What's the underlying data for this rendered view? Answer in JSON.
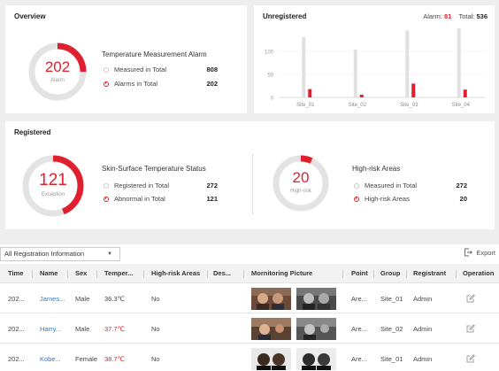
{
  "overview": {
    "title": "Overview",
    "ring_value": "202",
    "ring_label": "Alarm",
    "ring_fraction": 0.25,
    "heading": "Temperature Measurement Alarm",
    "rows": [
      {
        "label": "Measured in Total",
        "value": "808"
      },
      {
        "label": "Alarms in Total",
        "value": "202"
      }
    ]
  },
  "unregistered": {
    "title": "Unregistered",
    "alarm_label": "Alarm:",
    "alarm_value": "81",
    "total_label": "Total:",
    "total_value": "536",
    "y_ticks": [
      "100",
      "50",
      "0"
    ]
  },
  "chart_data": {
    "type": "bar",
    "categories": [
      "Site_01",
      "Site_02",
      "Site_03",
      "Site_04"
    ],
    "series": [
      {
        "values": [
          131,
          104,
          145,
          156
        ]
      },
      {
        "values": [
          18,
          6,
          30,
          17
        ]
      }
    ],
    "ylim": [
      0,
      150
    ],
    "y_ticks": [
      0,
      50,
      100
    ],
    "colors": [
      "#e0e0e0",
      "#e0202e"
    ]
  },
  "registered": {
    "title": "Registered",
    "skin": {
      "ring_value": "121",
      "ring_label": "Exception",
      "ring_fraction": 0.44,
      "heading": "Skin-Surface Temperature Status",
      "rows": [
        {
          "label": "Registered in Total",
          "value": "272"
        },
        {
          "label": "Abnormal in Total",
          "value": "121"
        }
      ]
    },
    "risk": {
      "ring_value": "20",
      "ring_label": "High-risk",
      "ring_fraction": 0.07,
      "heading": "High-risk Areas",
      "rows": [
        {
          "label": "Measured in Total",
          "value": "272"
        },
        {
          "label": "High-risk Areas",
          "value": "20"
        }
      ]
    }
  },
  "toolbar": {
    "filter_value": "All Registration Information",
    "export_label": "Export"
  },
  "table": {
    "columns": [
      "Time",
      "Name",
      "Sex",
      "Temper...",
      "High-risk Areas",
      "Des...",
      "Mornitoring Picture",
      "Point",
      "Group",
      "Registrant",
      "Operation"
    ],
    "rows": [
      {
        "time": "202...",
        "name": "James...",
        "sex": "Male",
        "temp": "36.3℃",
        "temp_abnormal": false,
        "risk": "No",
        "point": "Are...",
        "group": "Site_01",
        "registrant": "Admin"
      },
      {
        "time": "202...",
        "name": "Harry...",
        "sex": "Male",
        "temp": "37.7℃",
        "temp_abnormal": true,
        "risk": "No",
        "point": "Are...",
        "group": "Site_02",
        "registrant": "Admin"
      },
      {
        "time": "202...",
        "name": "Kobe...",
        "sex": "Female",
        "temp": "38.7℃",
        "temp_abnormal": true,
        "risk": "No",
        "point": "Are...",
        "group": "Site_01",
        "registrant": "Admin"
      }
    ]
  },
  "colors": {
    "accent": "#e0202e",
    "link": "#2a7ad0",
    "track": "#e3e3e3"
  }
}
